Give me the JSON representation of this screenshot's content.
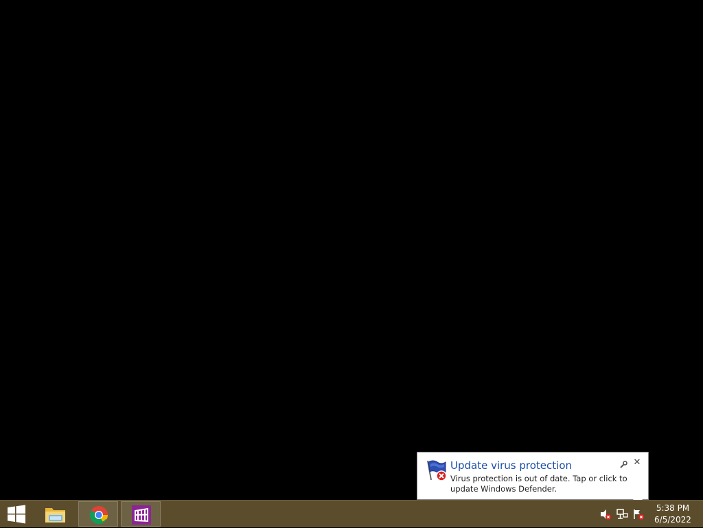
{
  "desktop": {
    "background": "#000000"
  },
  "notification": {
    "title": "Update virus protection",
    "message": "Virus protection is out of date. Tap or click to update Windows Defender.",
    "icon": "windows-defender-warning-flag-icon",
    "options_icon": "wrench-icon",
    "close_label": "✕"
  },
  "taskbar": {
    "color": "#5b4d2c",
    "start_icon": "windows-logo-icon",
    "pinned": [
      {
        "name": "File Explorer",
        "icon": "folder-icon",
        "active": false
      },
      {
        "name": "Google Chrome",
        "icon": "chrome-icon",
        "active": true
      },
      {
        "name": "Windows Store",
        "icon": "store-icon",
        "active": true
      }
    ],
    "tray": [
      {
        "name": "volume-muted-icon"
      },
      {
        "name": "network-disconnected-icon"
      },
      {
        "name": "action-center-flag-error-icon"
      }
    ],
    "clock": {
      "time": "5:38 PM",
      "date": "6/5/2022"
    }
  }
}
